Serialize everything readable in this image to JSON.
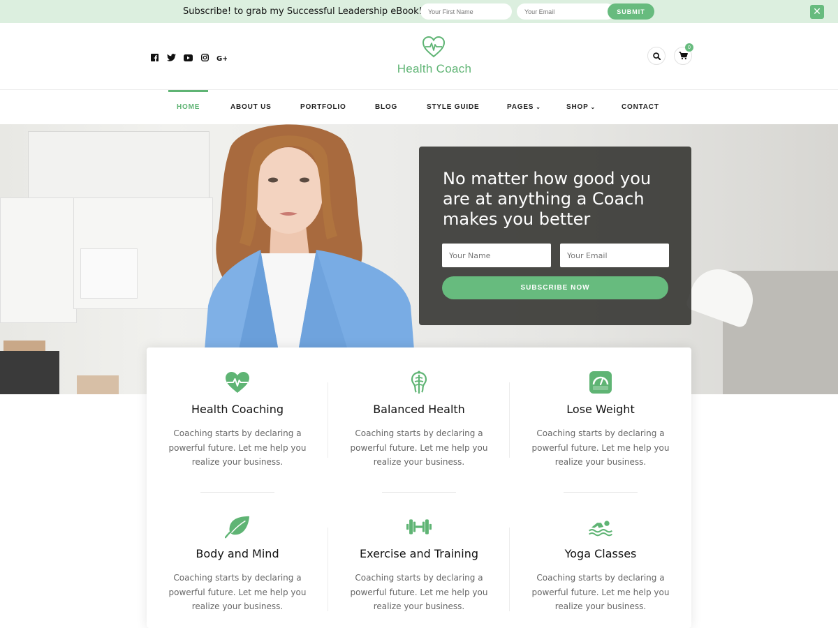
{
  "topbar": {
    "text": "Subscribe! to grab my Successful Leadership eBook!",
    "first_name_placeholder": "Your First Name",
    "email_placeholder": "Your Email",
    "submit_label": "SUBMIT",
    "close_label": "✕"
  },
  "header": {
    "social_icons": [
      "facebook-icon",
      "twitter-icon",
      "youtube-icon",
      "instagram-icon",
      "google-plus-icon"
    ],
    "logo_text": "Health Coach",
    "cart_count": "0"
  },
  "nav": {
    "items": [
      {
        "label": "HOME",
        "active": true
      },
      {
        "label": "ABOUT US"
      },
      {
        "label": "PORTFOLIO"
      },
      {
        "label": "BLOG"
      },
      {
        "label": "STYLE GUIDE"
      },
      {
        "label": "PAGES",
        "has_dropdown": true
      },
      {
        "label": "SHOP",
        "has_dropdown": true
      },
      {
        "label": "CONTACT"
      }
    ]
  },
  "hero": {
    "title": "No matter how good you are at anything a Coach makes you better",
    "name_placeholder": "Your Name",
    "email_placeholder": "Your Email",
    "button_label": "SUBSCRIBE NOW"
  },
  "features": [
    {
      "icon": "heart-pulse-icon",
      "title": "Health Coaching",
      "desc": "Coaching starts by declaring a powerful future. Let me help you realize your business."
    },
    {
      "icon": "balance-icon",
      "title": "Balanced Health",
      "desc": "Coaching starts by declaring a powerful future. Let me help you realize your business."
    },
    {
      "icon": "scale-icon",
      "title": "Lose Weight",
      "desc": "Coaching starts by declaring a powerful future. Let me help you realize your business."
    },
    {
      "icon": "leaf-icon",
      "title": "Body and Mind",
      "desc": "Coaching starts by declaring a powerful future. Let me help you realize your business."
    },
    {
      "icon": "dumbbell-icon",
      "title": "Exercise and Training",
      "desc": "Coaching starts by declaring a powerful future. Let me help you realize your business."
    },
    {
      "icon": "swimmer-icon",
      "title": "Yoga Classes",
      "desc": "Coaching starts by declaring a powerful future. Let me help you realize your business."
    }
  ],
  "colors": {
    "accent": "#67bb7e",
    "topbar_bg": "#dcefdf",
    "hero_card_bg": "#2d2d2a"
  }
}
